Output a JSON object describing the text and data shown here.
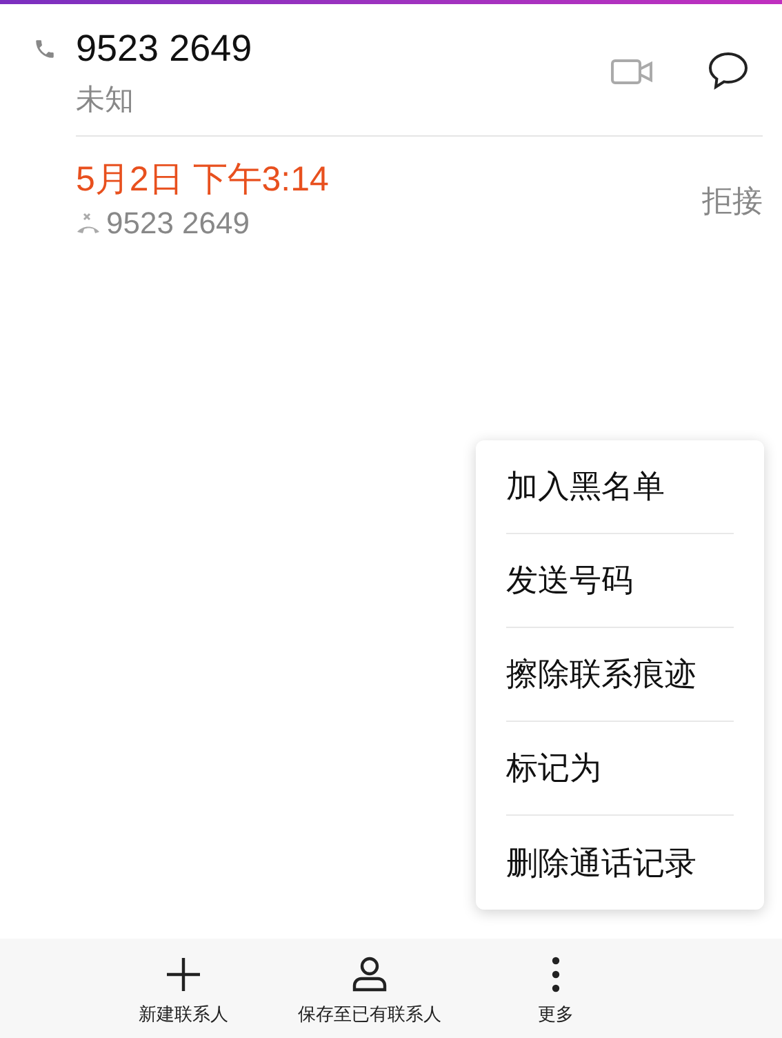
{
  "contact": {
    "number": "9523 2649",
    "label": "未知"
  },
  "call_log": [
    {
      "time": "5月2日 下午3:14",
      "number": "9523 2649",
      "status": "拒接"
    }
  ],
  "menu": [
    {
      "label": "加入黑名单"
    },
    {
      "label": "发送号码"
    },
    {
      "label": "擦除联系痕迹"
    },
    {
      "label": "标记为"
    },
    {
      "label": "删除通话记录"
    }
  ],
  "bottom_bar": [
    {
      "kind": "add",
      "label": "新建联系人"
    },
    {
      "kind": "contact",
      "label": "保存至已有联系人"
    },
    {
      "kind": "more",
      "label": "更多"
    }
  ]
}
